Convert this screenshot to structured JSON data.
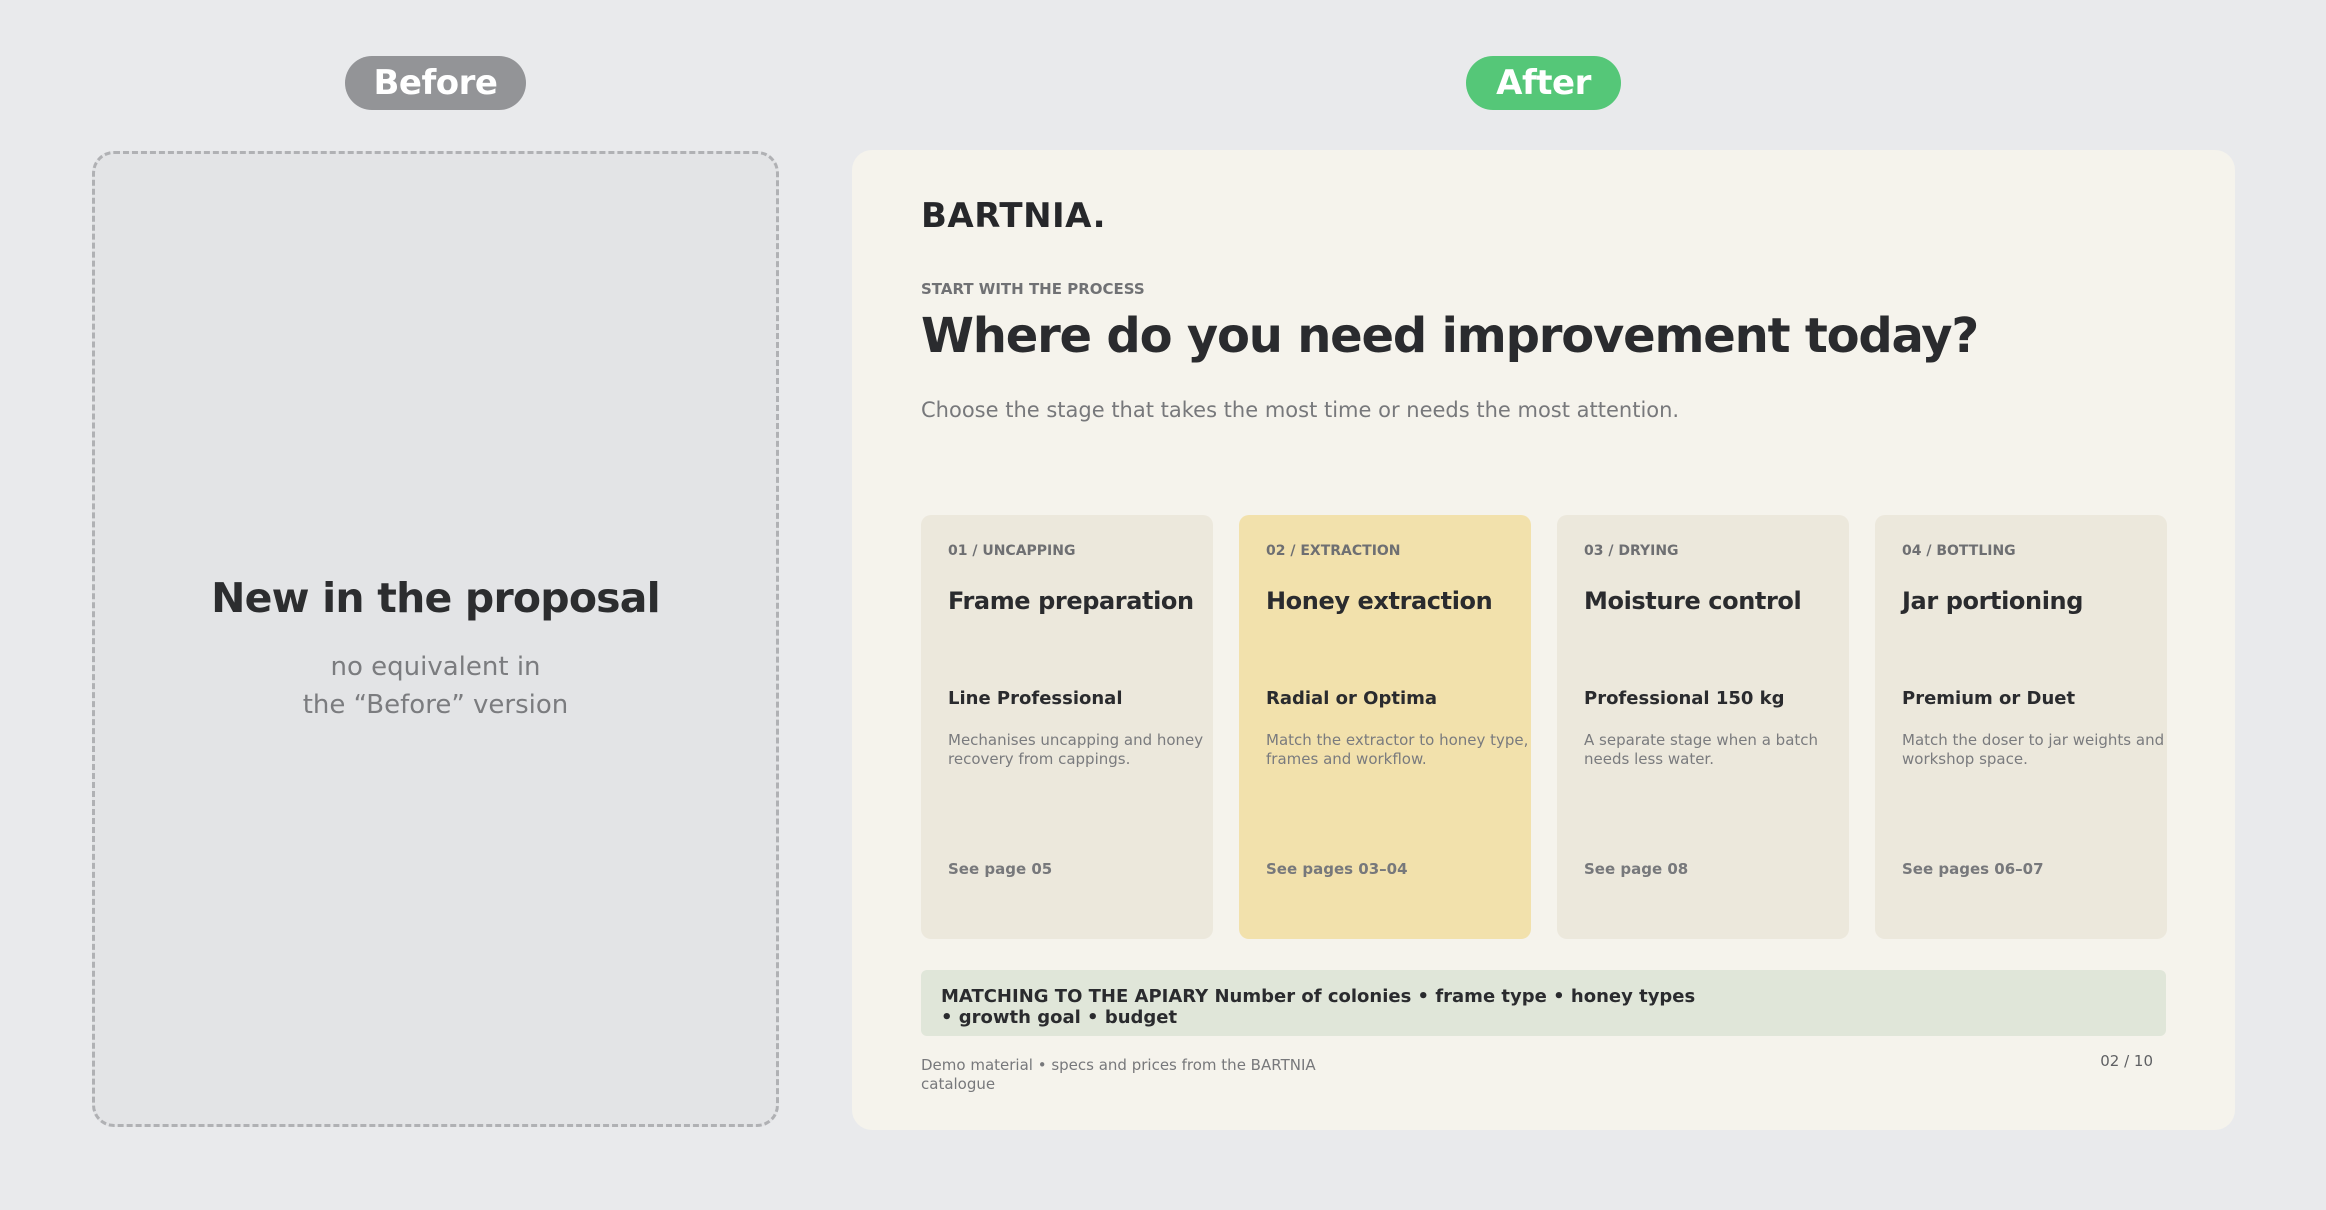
{
  "labels": {
    "before": "Before",
    "after": "After"
  },
  "before_panel": {
    "title": "New in the proposal",
    "subtitle_line1": "no equivalent in",
    "subtitle_line2": "the “Before” version"
  },
  "after_panel": {
    "logo": "BARTNIA.",
    "eyebrow": "START WITH THE PROCESS",
    "headline": "Where do you need improvement today?",
    "intro": "Choose the stage that takes the most time or needs the most attention.",
    "stages": [
      {
        "tag": "01 / UNCAPPING",
        "name": "Frame preparation",
        "model": "Line Professional",
        "description": "Mechanises uncapping and honey recovery from cappings.",
        "pages": "See page 05",
        "highlighted": false
      },
      {
        "tag": "02 / EXTRACTION",
        "name": "Honey extraction",
        "model": "Radial or Optima",
        "description": "Match the extractor to honey type, frames and workflow.",
        "pages": "See pages 03–04",
        "highlighted": true
      },
      {
        "tag": "03 / DRYING",
        "name": "Moisture control",
        "model": "Professional 150 kg",
        "description": "A separate stage when a batch needs less water.",
        "pages": "See page 08",
        "highlighted": false
      },
      {
        "tag": "04 / BOTTLING",
        "name": "Jar portioning",
        "model": "Premium or Duet",
        "description": "Match the doser to jar weights and workshop space.",
        "pages": "See pages 06–07",
        "highlighted": false
      }
    ],
    "matching": "MATCHING TO THE APIARY Number of colonies • frame type • honey types • growth goal • budget",
    "footer_note": "Demo material • specs and prices from the BARTNIA catalogue",
    "page_number": "02 / 10"
  },
  "colors": {
    "background": "#e9eaec",
    "before_pill": "#939497",
    "after_pill": "#55c778",
    "card": "#ece8dc",
    "card_highlight": "#f2e1ac",
    "matching_bar": "#e0e6d9"
  }
}
